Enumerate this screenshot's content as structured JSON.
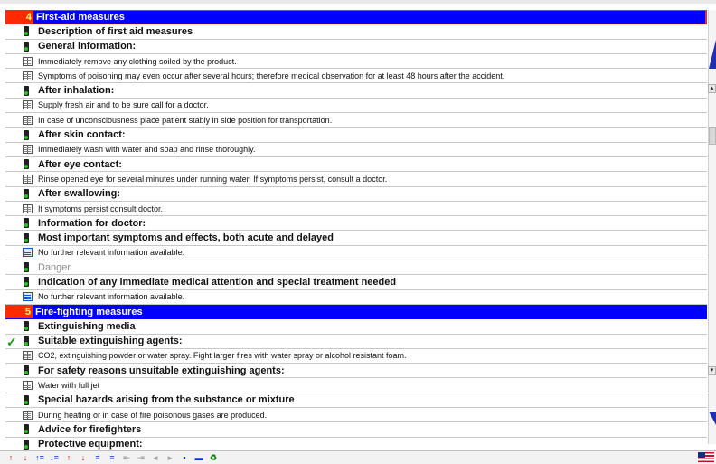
{
  "rows": [
    {
      "kind": "section",
      "num": "4",
      "text": "First-aid measures"
    },
    {
      "kind": "bold",
      "icon": "traffic-light-icon",
      "text": "Description of first aid measures"
    },
    {
      "kind": "bold",
      "icon": "traffic-light-icon",
      "text": "General information:"
    },
    {
      "kind": "plain",
      "icon": "book-icon",
      "text": "Immediately remove any clothing soiled by the product."
    },
    {
      "kind": "plain",
      "icon": "book-icon",
      "text": "Symptoms of poisoning may even occur after several hours; therefore medical observation for at least 48 hours after the accident."
    },
    {
      "kind": "bold",
      "icon": "traffic-light-icon",
      "text": "After inhalation:"
    },
    {
      "kind": "plain",
      "icon": "book-icon",
      "text": "Supply fresh air and to be sure call for a doctor."
    },
    {
      "kind": "plain",
      "icon": "book-icon",
      "text": "In case of unconsciousness place patient stably in side position for transportation."
    },
    {
      "kind": "bold",
      "icon": "traffic-light-icon",
      "text": "After skin contact:"
    },
    {
      "kind": "plain",
      "icon": "book-icon",
      "text": "Immediately wash with water and soap and rinse thoroughly."
    },
    {
      "kind": "bold",
      "icon": "traffic-light-icon",
      "text": "After eye contact:"
    },
    {
      "kind": "plain",
      "icon": "book-icon",
      "text": "Rinse opened eye for several minutes under running water. If symptoms persist, consult a doctor."
    },
    {
      "kind": "bold",
      "icon": "traffic-light-icon",
      "text": "After swallowing:"
    },
    {
      "kind": "plain",
      "icon": "book-icon",
      "text": "If symptoms persist consult doctor."
    },
    {
      "kind": "bold",
      "icon": "traffic-light-icon",
      "text": "Information for doctor:"
    },
    {
      "kind": "bold",
      "icon": "traffic-light-icon",
      "text": "Most important symptoms and effects, both acute and delayed"
    },
    {
      "kind": "plain",
      "icon": "list-icon",
      "text": "No further relevant information available."
    },
    {
      "kind": "gray",
      "icon": "traffic-light-icon",
      "text": "Danger"
    },
    {
      "kind": "bold",
      "icon": "traffic-light-icon",
      "text": "Indication of any immediate medical attention and special treatment needed"
    },
    {
      "kind": "plain",
      "icon": "list-icon",
      "text": "No further relevant information available."
    },
    {
      "kind": "section",
      "num": "5",
      "text": "Fire-fighting measures"
    },
    {
      "kind": "bold",
      "icon": "traffic-light-icon",
      "text": "Extinguishing media"
    },
    {
      "kind": "bold",
      "icon": "traffic-light-icon",
      "text": "Suitable extinguishing agents:",
      "checked": true
    },
    {
      "kind": "plain",
      "icon": "book-icon",
      "text": "CO2, extinguishing powder or water spray. Fight larger fires with water spray or alcohol resistant foam."
    },
    {
      "kind": "bold",
      "icon": "traffic-light-icon",
      "text": "For safety reasons unsuitable extinguishing agents:"
    },
    {
      "kind": "plain",
      "icon": "book-icon",
      "text": "Water with full jet"
    },
    {
      "kind": "bold",
      "icon": "traffic-light-icon",
      "text": "Special hazards arising from the substance or mixture"
    },
    {
      "kind": "plain",
      "icon": "book-icon",
      "text": "During heating or in case of fire poisonous gases are produced."
    },
    {
      "kind": "bold",
      "icon": "traffic-light-icon",
      "text": "Advice for firefighters"
    },
    {
      "kind": "bold",
      "icon": "traffic-light-icon",
      "text": "Protective equipment:"
    }
  ],
  "toolbar": [
    "move-up-red-icon",
    "move-down-red-icon",
    "move-up-list-icon",
    "move-down-list-icon",
    "arrow-up-red-icon",
    "arrow-down-red-icon",
    "insert-list-icon",
    "delete-list-icon",
    "indent-left-icon",
    "indent-right-icon",
    "collapse-icon",
    "expand-icon",
    "print-icon",
    "screen-icon",
    "recycle-icon"
  ],
  "colors": {
    "section_bg": "#0000ff",
    "section_num_bg": "#ff2a00",
    "check": "#1a9a1a"
  },
  "language_flag": "us-flag-icon"
}
